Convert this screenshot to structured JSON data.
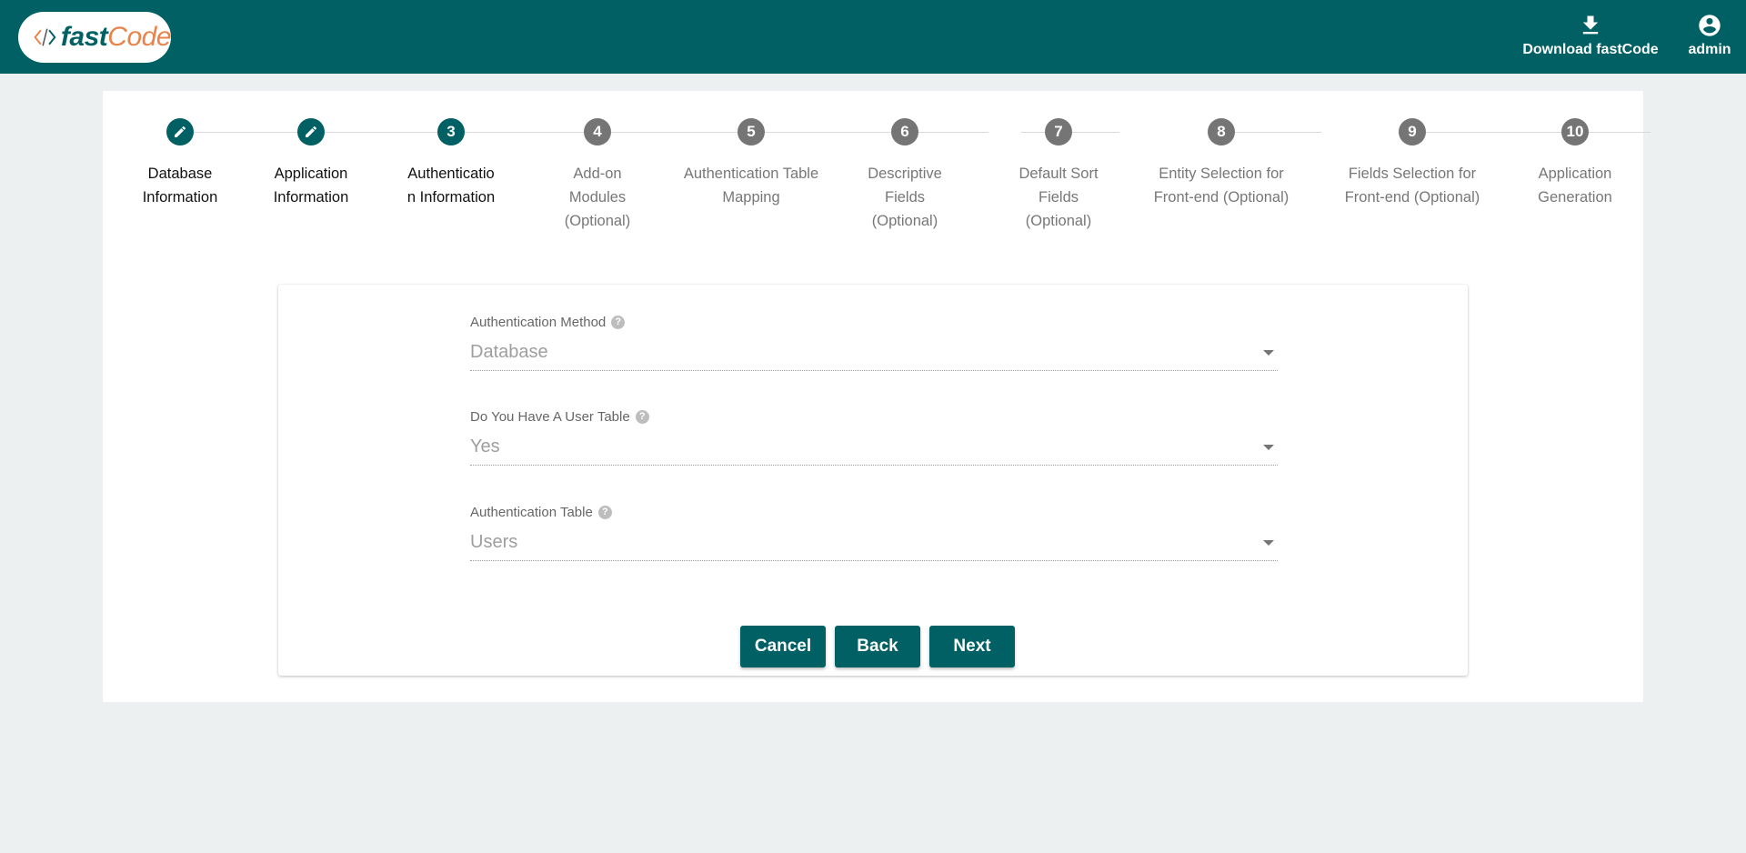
{
  "header": {
    "logo": {
      "fast": "fast",
      "code": "Code"
    },
    "download_label": "Download fastCode",
    "user_label": "admin"
  },
  "stepper": {
    "steps": [
      {
        "number": "",
        "label": "Database Information",
        "state": "completed"
      },
      {
        "number": "",
        "label": "Application Information",
        "state": "completed"
      },
      {
        "number": "3",
        "label": "Authenticatio n Information",
        "state": "active"
      },
      {
        "number": "4",
        "label": "Add-on Modules (Optional)",
        "state": "pending"
      },
      {
        "number": "5",
        "label": "Authentication Table Mapping",
        "state": "pending"
      },
      {
        "number": "6",
        "label": "Descriptive Fields (Optional)",
        "state": "pending"
      },
      {
        "number": "7",
        "label": "Default Sort Fields (Optional)",
        "state": "pending"
      },
      {
        "number": "8",
        "label": "Entity Selection for Front-end (Optional)",
        "state": "pending"
      },
      {
        "number": "9",
        "label": "Fields Selection for Front-end (Optional)",
        "state": "pending"
      },
      {
        "number": "10",
        "label": "Application Generation",
        "state": "pending"
      }
    ]
  },
  "form": {
    "auth_method": {
      "label": "Authentication Method",
      "value": "Database"
    },
    "user_table": {
      "label": "Do You Have A User Table",
      "value": "Yes"
    },
    "auth_table": {
      "label": "Authentication Table",
      "value": "Users"
    },
    "help_glyph": "?",
    "buttons": {
      "cancel": "Cancel",
      "back": "Back",
      "next": "Next"
    }
  },
  "colors": {
    "primary": "#006064",
    "accent": "#e8834a",
    "step_pending": "#757575",
    "background": "#ecf0f1"
  }
}
